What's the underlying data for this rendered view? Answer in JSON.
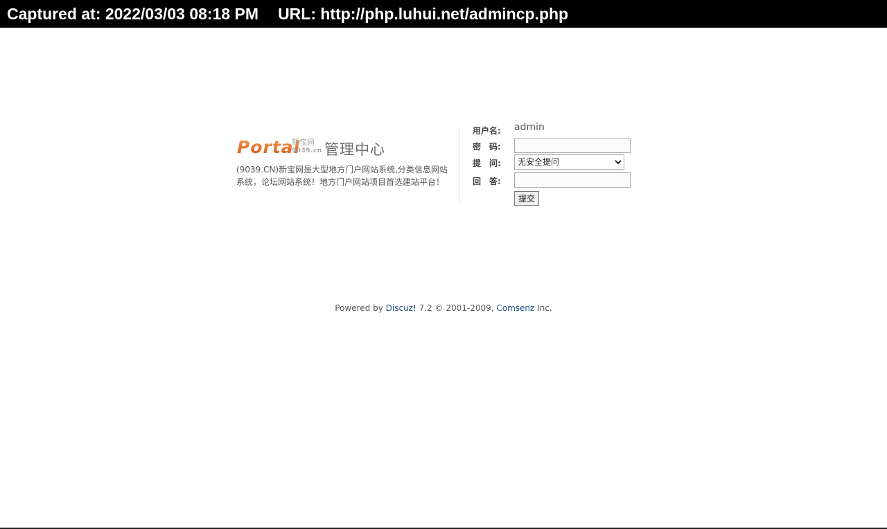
{
  "capture": {
    "captured_label": "Captured at: 2022/03/03 08:18 PM",
    "url_label": "URL: http://php.luhui.net/admincp.php"
  },
  "logo": {
    "portal": "Portal",
    "site_cn": "新宝网",
    "site_domain": "9039.cn",
    "title": "管理中心"
  },
  "intro_text": "(9039.CN)新宝网是大型地方门户网站系统,分类信息网站系统，论坛网站系统！地方门户网站项目首选建站平台！",
  "form": {
    "username_label": "用户名:",
    "username_value": "admin",
    "password_label": "密　码:",
    "question_label": "提　问:",
    "question_selected": "无安全提问",
    "answer_label": "回　答:",
    "submit_label": "提交"
  },
  "footer": {
    "powered_by": "Powered by",
    "discuz_link": "Discuz!",
    "version_copy": "7.2 © 2001-2009,",
    "comsenz_link": "Comsenz",
    "inc": "Inc."
  },
  "colors": {
    "capture_bar_bg": "#000000",
    "logo_orange": "#e8701a",
    "link_blue": "#1f4e8a"
  }
}
